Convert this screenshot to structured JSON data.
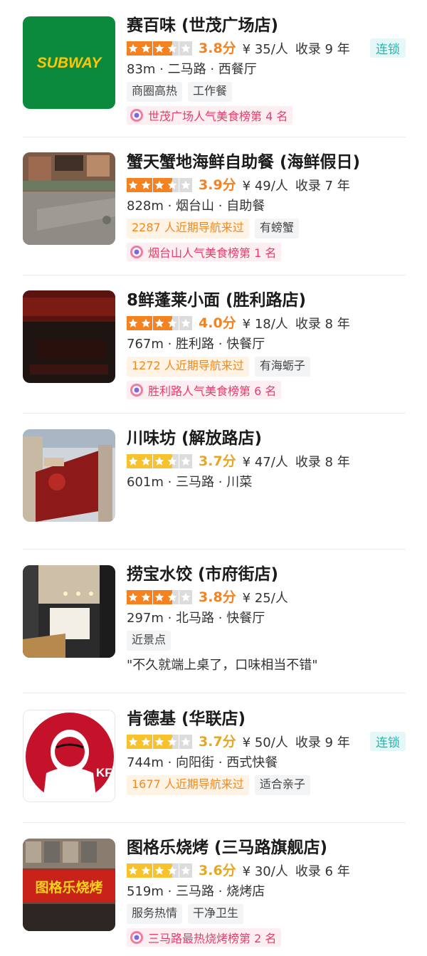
{
  "colors": {
    "star_orange": "#f5821f",
    "star_yellow": "#f7c22b",
    "star_empty": "#dcdcdc",
    "score_orange": "#f5821f",
    "score_yellow": "#e8a720",
    "chain_teal": "#1ab9b3",
    "rank_pink": "#e83c6b"
  },
  "restaurants": [
    {
      "name": "赛百味 (世茂广场店)",
      "logo_text": "SUBWAY",
      "stars": 3.5,
      "star_color": "orange",
      "score": "3.8分",
      "price": "¥ 35/人",
      "since": "收录 9 年",
      "chain": "连锁",
      "location": "83m · 二马路 · 西餐厅",
      "tags": [
        {
          "text": "商圈高热",
          "style": "plain"
        },
        {
          "text": "工作餐",
          "style": "plain"
        }
      ],
      "rank": "世茂广场人气美食榜第 4 名"
    },
    {
      "name": "蟹天蟹地海鲜自助餐 (海鲜假日)",
      "stars": 3.5,
      "star_color": "orange",
      "score": "3.9分",
      "price": "¥ 49/人",
      "since": "收录 7 年",
      "location": "828m · 烟台山 · 自助餐",
      "tags": [
        {
          "text": "2287 人近期导航来过",
          "style": "warm"
        },
        {
          "text": "有螃蟹",
          "style": "plain"
        }
      ],
      "rank": "烟台山人气美食榜第 1 名"
    },
    {
      "name": "8鲜蓬莱小面 (胜利路店)",
      "stars": 3.5,
      "star_color": "orange",
      "score": "4.0分",
      "price": "¥ 18/人",
      "since": "收录 8 年",
      "location": "767m · 胜利路 · 快餐厅",
      "tags": [
        {
          "text": "1272 人近期导航来过",
          "style": "warm"
        },
        {
          "text": "有海蛎子",
          "style": "plain"
        }
      ],
      "rank": "胜利路人气美食榜第 6 名"
    },
    {
      "name": "川味坊 (解放路店)",
      "stars": 3.5,
      "star_color": "yellow",
      "score": "3.7分",
      "price": "¥ 47/人",
      "since": "收录 8 年",
      "location": "601m · 三马路 · 川菜"
    },
    {
      "name": "捞宝水饺 (市府街店)",
      "stars": 3.5,
      "star_color": "orange",
      "score": "3.8分",
      "price": "¥ 25/人",
      "location": "297m · 北马路 · 快餐厅",
      "tags": [
        {
          "text": "近景点",
          "style": "plain"
        }
      ],
      "quote": "\"不久就端上桌了，口味相当不错\""
    },
    {
      "name": "肯德基 (华联店)",
      "logo_text": "KFC",
      "stars": 3.5,
      "star_color": "yellow",
      "score": "3.7分",
      "price": "¥ 50/人",
      "since": "收录 9 年",
      "chain": "连锁",
      "location": "744m · 向阳街 · 西式快餐",
      "tags": [
        {
          "text": "1677 人近期导航来过",
          "style": "warm"
        },
        {
          "text": "适合亲子",
          "style": "plain"
        }
      ]
    },
    {
      "name": "图格乐烧烤 (三马路旗舰店)",
      "logo_text": "图格乐烧烤",
      "stars": 3.5,
      "star_color": "yellow",
      "score": "3.6分",
      "price": "¥ 30/人",
      "since": "收录 6 年",
      "location": "519m · 三马路 · 烧烤店",
      "tags": [
        {
          "text": "服务热情",
          "style": "plain"
        },
        {
          "text": "干净卫生",
          "style": "plain"
        }
      ],
      "rank": "三马路最热烧烤榜第 2 名"
    }
  ]
}
